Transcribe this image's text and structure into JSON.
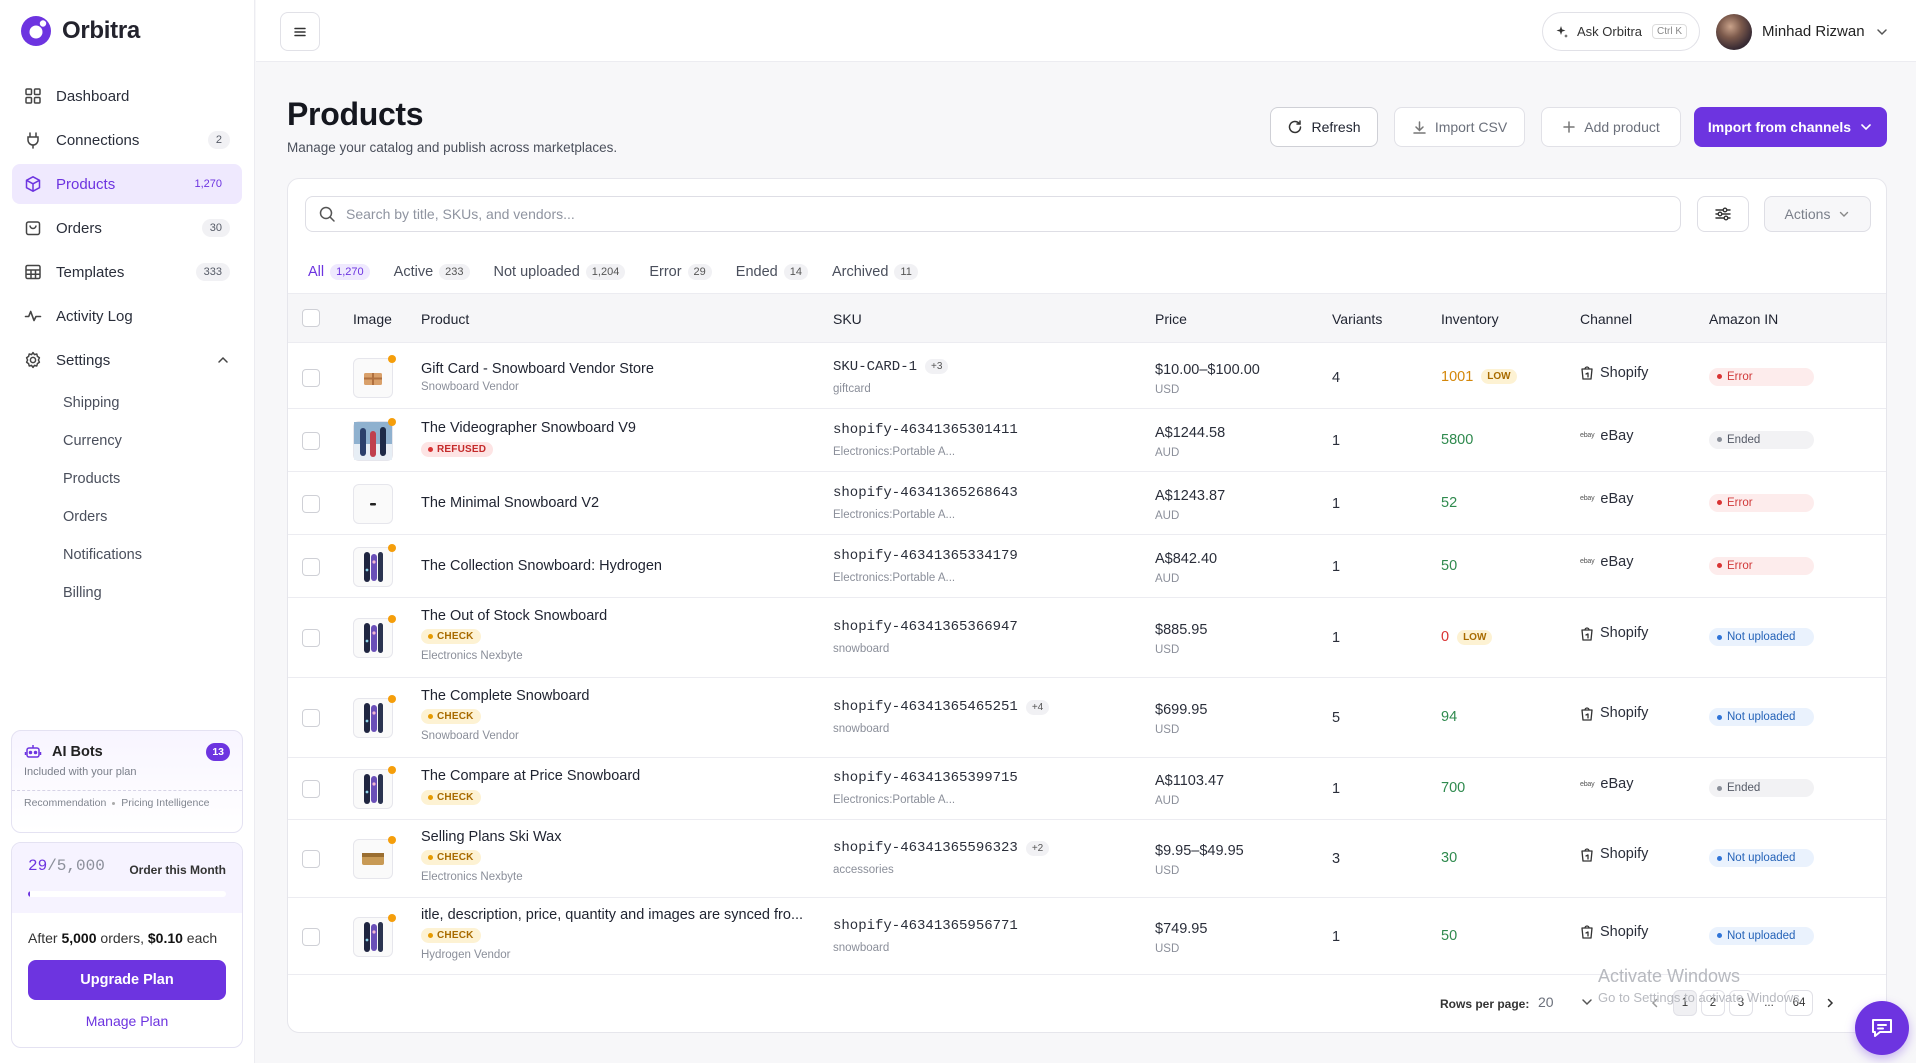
{
  "app": {
    "name": "Orbitra"
  },
  "nav": [
    {
      "key": "dashboard",
      "label": "Dashboard",
      "badge": null,
      "active": false
    },
    {
      "key": "connections",
      "label": "Connections",
      "badge": "2",
      "active": false
    },
    {
      "key": "products",
      "label": "Products",
      "badge": "1,270",
      "active": true
    },
    {
      "key": "orders",
      "label": "Orders",
      "badge": "30",
      "active": false
    },
    {
      "key": "templates",
      "label": "Templates",
      "badge": "333",
      "active": false
    },
    {
      "key": "activity",
      "label": "Activity Log",
      "badge": null,
      "active": false
    },
    {
      "key": "settings",
      "label": "Settings",
      "badge": null,
      "active": false
    }
  ],
  "settings_sub": [
    "Shipping",
    "Currency",
    "Products",
    "Orders",
    "Notifications",
    "Billing"
  ],
  "ai_bots": {
    "title": "AI Bots",
    "badge": "13",
    "subtitle": "Included with your plan",
    "tags": [
      "Recommendation",
      "Pricing Intelligence"
    ]
  },
  "plan": {
    "used": "29",
    "limit": "/5,000",
    "label": "Order this Month",
    "fraction": 0.0058,
    "after_prefix": "After ",
    "after_orders": "5,000",
    "after_mid": " orders, ",
    "after_price": "$0.10",
    "after_suffix": " each",
    "upgrade": "Upgrade Plan",
    "manage": "Manage Plan"
  },
  "topbar": {
    "ask": "Ask Orbitra",
    "shortcut": "Ctrl K",
    "user": "Minhad Rizwan"
  },
  "page": {
    "title": "Products",
    "subtitle": "Manage your catalog and publish across marketplaces."
  },
  "buttons": {
    "refresh": "Refresh",
    "import_csv": "Import CSV",
    "add_product": "Add product",
    "import_channels": "Import from channels"
  },
  "search": {
    "placeholder": "Search by title, SKUs, and vendors..."
  },
  "actions": {
    "label": "Actions"
  },
  "tabs": [
    {
      "label": "All",
      "count": "1,270",
      "active": true
    },
    {
      "label": "Active",
      "count": "233",
      "active": false
    },
    {
      "label": "Not uploaded",
      "count": "1,204",
      "active": false
    },
    {
      "label": "Error",
      "count": "29",
      "active": false
    },
    {
      "label": "Ended",
      "count": "14",
      "active": false
    },
    {
      "label": "Archived",
      "count": "11",
      "active": false
    }
  ],
  "columns": {
    "image": "Image",
    "product": "Product",
    "sku": "SKU",
    "price": "Price",
    "variants": "Variants",
    "inventory": "Inventory",
    "channel": "Channel",
    "amazon": "Amazon IN"
  },
  "rows": [
    {
      "name": "Gift Card - Snowboard Vendor Store",
      "tag": null,
      "vendor": "Snowboard Vendor",
      "sku": "SKU-CARD-1",
      "sku_more": "+3",
      "sku_cat": "giftcard",
      "price": "$10.00–$100.00",
      "currency": "USD",
      "variants": "4",
      "inventory": "1001",
      "inv_color": "orange",
      "low": "LOW",
      "channel": "Shopify",
      "status": "Error",
      "thumb": "gift",
      "dot": true
    },
    {
      "name": "The Videographer Snowboard V9",
      "tag": "REFUSED",
      "vendor": null,
      "sku": "shopify-46341365301411",
      "sku_more": null,
      "sku_cat": "Electronics:Portable A...",
      "price": "A$1244.58",
      "currency": "AUD",
      "variants": "1",
      "inventory": "5800",
      "inv_color": "green",
      "low": null,
      "channel": "eBay",
      "status": "Ended",
      "thumb": "photo",
      "dot": true
    },
    {
      "name": "The Minimal Snowboard V2",
      "tag": null,
      "vendor": null,
      "sku": "shopify-46341365268643",
      "sku_more": null,
      "sku_cat": "Electronics:Portable A...",
      "price": "A$1243.87",
      "currency": "AUD",
      "variants": "1",
      "inventory": "52",
      "inv_color": "green",
      "low": null,
      "channel": "eBay",
      "status": "Error",
      "thumb": "minimal",
      "dot": false
    },
    {
      "name": "The Collection Snowboard: Hydrogen",
      "tag": null,
      "vendor": null,
      "sku": "shopify-46341365334179",
      "sku_more": null,
      "sku_cat": "Electronics:Portable A...",
      "price": "A$842.40",
      "currency": "AUD",
      "variants": "1",
      "inventory": "50",
      "inv_color": "green",
      "low": null,
      "channel": "eBay",
      "status": "Error",
      "thumb": "board",
      "dot": true
    },
    {
      "name": "The Out of Stock Snowboard",
      "tag": "CHECK",
      "vendor": "Electronics Nexbyte",
      "sku": "shopify-46341365366947",
      "sku_more": null,
      "sku_cat": "snowboard",
      "price": "$885.95",
      "currency": "USD",
      "variants": "1",
      "inventory": "0",
      "inv_color": "red",
      "low": "LOW",
      "channel": "Shopify",
      "status": "Not uploaded",
      "thumb": "board",
      "dot": true
    },
    {
      "name": "The Complete Snowboard",
      "tag": "CHECK",
      "vendor": "Snowboard Vendor",
      "sku": "shopify-46341365465251",
      "sku_more": "+4",
      "sku_cat": "snowboard",
      "price": "$699.95",
      "currency": "USD",
      "variants": "5",
      "inventory": "94",
      "inv_color": "green",
      "low": null,
      "channel": "Shopify",
      "status": "Not uploaded",
      "thumb": "board",
      "dot": true
    },
    {
      "name": "The Compare at Price Snowboard",
      "tag": "CHECK",
      "vendor": null,
      "sku": "shopify-46341365399715",
      "sku_more": null,
      "sku_cat": "Electronics:Portable A...",
      "price": "A$1103.47",
      "currency": "AUD",
      "variants": "1",
      "inventory": "700",
      "inv_color": "green",
      "low": null,
      "channel": "eBay",
      "status": "Ended",
      "thumb": "board",
      "dot": true
    },
    {
      "name": "Selling Plans Ski Wax",
      "tag": "CHECK",
      "vendor": "Electronics Nexbyte",
      "sku": "shopify-46341365596323",
      "sku_more": "+2",
      "sku_cat": "accessories",
      "price": "$9.95–$49.95",
      "currency": "USD",
      "variants": "3",
      "inventory": "30",
      "inv_color": "green",
      "low": null,
      "channel": "Shopify",
      "status": "Not uploaded",
      "thumb": "wax",
      "dot": true
    },
    {
      "name": "itle, description, price, quantity and images are synced fro...",
      "tag": "CHECK",
      "vendor": "Hydrogen Vendor",
      "sku": "shopify-46341365956771",
      "sku_more": null,
      "sku_cat": "snowboard",
      "price": "$749.95",
      "currency": "USD",
      "variants": "1",
      "inventory": "50",
      "inv_color": "green",
      "low": null,
      "channel": "Shopify",
      "status": "Not uploaded",
      "thumb": "board",
      "dot": true
    }
  ],
  "pagination": {
    "rows_label": "Rows per page:",
    "rows_value": "20",
    "pages": [
      "1",
      "2",
      "3",
      "...",
      "64"
    ]
  },
  "watermark": {
    "line1": "Activate Windows",
    "line2": "Go to Settings to activate Windows."
  },
  "colors": {
    "accent": "#6d34e0",
    "error": "#d93333",
    "ok": "#2f8a4e",
    "warn": "#d4870a",
    "info": "#2f74d8"
  }
}
